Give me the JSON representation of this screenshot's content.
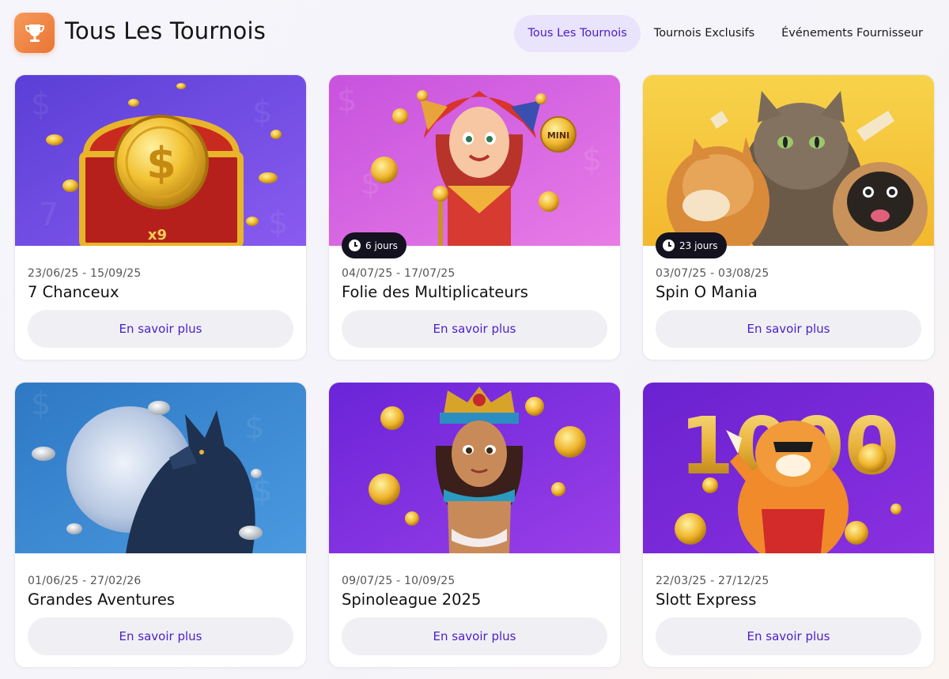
{
  "header": {
    "title": "Tous Les Tournois",
    "logo_icon": "trophy-icon",
    "accent_color": "#ea7533"
  },
  "tabs": [
    {
      "label": "Tous Les Tournois",
      "active": true
    },
    {
      "label": "Tournois Exclusifs",
      "active": false
    },
    {
      "label": "Événements Fournisseur",
      "active": false
    }
  ],
  "cards": [
    {
      "dates": "23/06/25 - 15/09/25",
      "name": "7 Chanceux",
      "button": "En savoir plus",
      "badge": "",
      "art": "treasure-chest-image"
    },
    {
      "dates": "04/07/25 - 17/07/25",
      "name": "Folie des Multiplicateurs",
      "button": "En savoir plus",
      "badge": "6 jours",
      "art": "jester-girl-image",
      "art_text": "MINI"
    },
    {
      "dates": "03/07/25 - 03/08/25",
      "name": "Spin O Mania",
      "button": "En savoir plus",
      "badge": "23 jours",
      "art": "cat-dogs-image"
    },
    {
      "dates": "01/06/25 - 27/02/26",
      "name": "Grandes Aventures",
      "button": "En savoir plus",
      "badge": "",
      "art": "wolf-moon-image"
    },
    {
      "dates": "09/07/25 - 10/09/25",
      "name": "Spinoleague 2025",
      "button": "En savoir plus",
      "badge": "",
      "art": "cleopatra-image"
    },
    {
      "dates": "22/03/25 - 27/12/25",
      "name": "Slott Express",
      "button": "En savoir plus",
      "badge": "",
      "art": "tiger-1000-image",
      "art_text": "1000"
    }
  ]
}
